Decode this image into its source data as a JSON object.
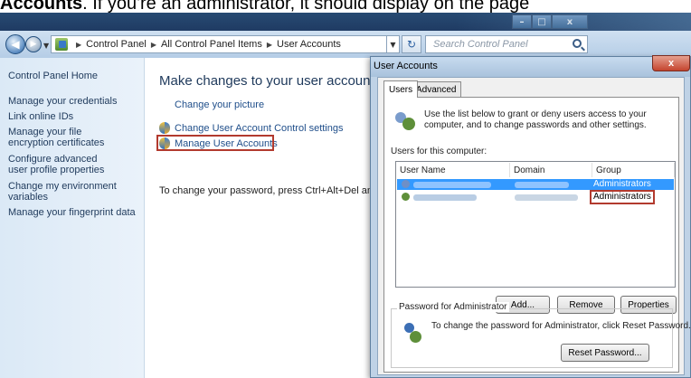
{
  "caption": {
    "bold": "Accounts",
    "rest": ". If you're an administrator, it should display on the page"
  },
  "window": {
    "minimize": "–",
    "maximize": "□",
    "close": "x"
  },
  "address": {
    "crumbs": [
      "Control Panel",
      "All Control Panel Items",
      "User Accounts"
    ],
    "search_placeholder": "Search Control Panel"
  },
  "sidebar": {
    "items": [
      "Control Panel Home",
      "Manage your credentials",
      "Link online IDs",
      "Manage your file encryption certificates",
      "Configure advanced user profile properties",
      "Change my environment variables",
      "Manage your fingerprint data"
    ]
  },
  "main": {
    "title": "Make changes to your user account",
    "links": [
      "Change your picture",
      "Change User Account Control settings",
      "Manage User Accounts"
    ],
    "instruction": "To change your password, press Ctrl+Alt+Del and select Change a password."
  },
  "dialog": {
    "title": "User Accounts",
    "close": "x",
    "tabs": [
      "Users",
      "Advanced"
    ],
    "info": "Use the list below to grant or deny users access to your computer, and to change passwords and other settings.",
    "users_label": "Users for this computer:",
    "columns": [
      "User Name",
      "Domain",
      "Group"
    ],
    "rows": [
      {
        "group": "Administrators",
        "selected": true
      },
      {
        "group": "Administrators",
        "selected": false
      }
    ],
    "buttons": {
      "add": "Add...",
      "remove": "Remove",
      "properties": "Properties"
    },
    "password_group": {
      "legend": "Password for Administrator",
      "text": "To change the password for Administrator, click Reset Password.",
      "reset": "Reset Password..."
    }
  },
  "colors": {
    "highlight": "#b23a2e",
    "link": "#1f4e8a",
    "selection": "#3399ff"
  }
}
